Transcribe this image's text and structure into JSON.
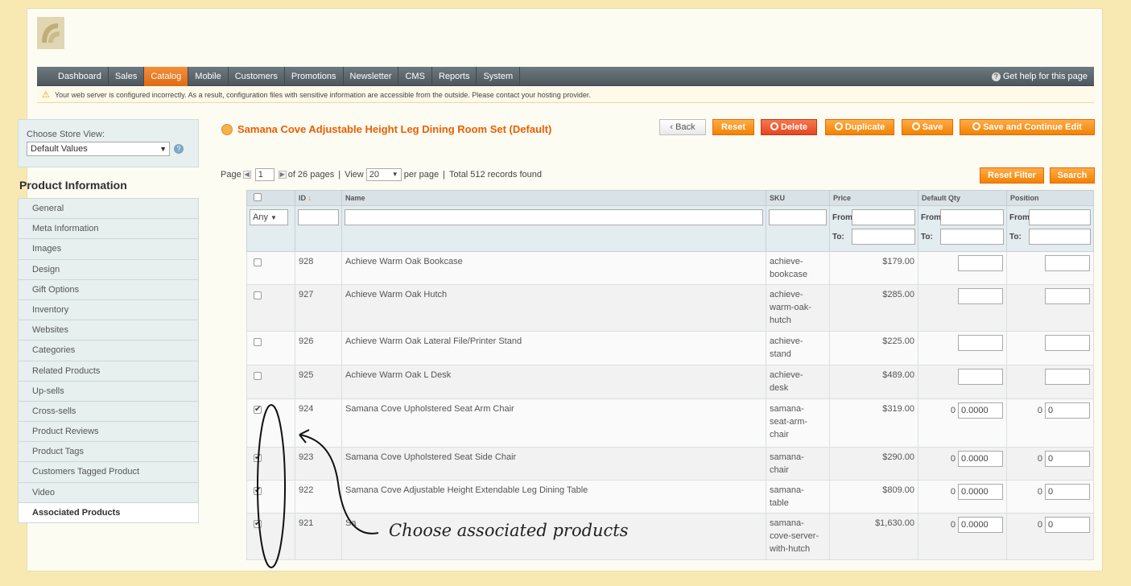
{
  "nav": {
    "items": [
      "Dashboard",
      "Sales",
      "Catalog",
      "Mobile",
      "Customers",
      "Promotions",
      "Newsletter",
      "CMS",
      "Reports",
      "System"
    ],
    "active_index": 2,
    "help": "Get help for this page"
  },
  "notice": {
    "text": "Your web server is configured incorrectly. As a result, configuration files with sensitive information are accessible from the outside. Please contact your hosting provider."
  },
  "sidebar": {
    "store_view_label": "Choose Store View:",
    "store_view_value": "Default Values",
    "title": "Product Information",
    "tabs": [
      "General",
      "Meta Information",
      "Images",
      "Design",
      "Gift Options",
      "Inventory",
      "Websites",
      "Categories",
      "Related Products",
      "Up-sells",
      "Cross-sells",
      "Product Reviews",
      "Product Tags",
      "Customers Tagged Product",
      "Video",
      "Associated Products"
    ],
    "active_tab": "Associated Products"
  },
  "header": {
    "title": "Samana Cove Adjustable Height Leg Dining Room Set (Default)",
    "buttons": {
      "back": "Back",
      "reset": "Reset",
      "delete": "Delete",
      "duplicate": "Duplicate",
      "save": "Save",
      "save_continue": "Save and Continue Edit"
    }
  },
  "pager": {
    "page_label": "Page",
    "page_value": "1",
    "of_pages": "of 26 pages",
    "view_label": "View",
    "view_value": "20",
    "per_page": "per page",
    "total": "Total 512 records found",
    "reset_filter": "Reset Filter",
    "search": "Search"
  },
  "grid": {
    "headers": {
      "id": "ID",
      "name": "Name",
      "sku": "SKU",
      "price": "Price",
      "default_qty": "Default Qty",
      "position": "Position"
    },
    "filter": {
      "select_value": "Any",
      "from": "From:",
      "to": "To:"
    },
    "rows": [
      {
        "id": "928",
        "name": "Achieve Warm Oak Bookcase",
        "sku": "achieve-\nbookcase",
        "price": "$179.00",
        "checked": false,
        "qty_label": "",
        "qty": "",
        "pos_label": "",
        "pos": ""
      },
      {
        "id": "927",
        "name": "Achieve Warm Oak Hutch",
        "sku": "achieve-\nwarm-oak-\nhutch",
        "price": "$285.00",
        "checked": false,
        "qty_label": "",
        "qty": "",
        "pos_label": "",
        "pos": ""
      },
      {
        "id": "926",
        "name": "Achieve Warm Oak Lateral File/Printer Stand",
        "sku": "achieve-\nstand",
        "price": "$225.00",
        "checked": false,
        "qty_label": "",
        "qty": "",
        "pos_label": "",
        "pos": ""
      },
      {
        "id": "925",
        "name": "Achieve Warm Oak L Desk",
        "sku": "achieve-\ndesk",
        "price": "$489.00",
        "checked": false,
        "qty_label": "",
        "qty": "",
        "pos_label": "",
        "pos": ""
      },
      {
        "id": "924",
        "name": "Samana Cove Upholstered Seat Arm Chair",
        "sku": "samana-\nseat-arm-\nchair",
        "price": "$319.00",
        "checked": true,
        "qty_label": "0",
        "qty": "0.0000",
        "pos_label": "0",
        "pos": "0"
      },
      {
        "id": "923",
        "name": "Samana Cove Upholstered Seat Side Chair",
        "sku": "samana-\nchair",
        "price": "$290.00",
        "checked": true,
        "qty_label": "0",
        "qty": "0.0000",
        "pos_label": "0",
        "pos": "0"
      },
      {
        "id": "922",
        "name": "Samana Cove Adjustable Height Extendable Leg Dining Table",
        "sku": "samana-\ntable",
        "price": "$809.00",
        "checked": true,
        "qty_label": "0",
        "qty": "0.0000",
        "pos_label": "0",
        "pos": "0"
      },
      {
        "id": "921",
        "name": "Sa",
        "sku": "samana-\ncove-server-\nwith-hutch",
        "price": "$1,630.00",
        "checked": true,
        "qty_label": "0",
        "qty": "0.0000",
        "pos_label": "0",
        "pos": "0"
      }
    ]
  },
  "annotation": {
    "text": "Choose associated products"
  }
}
